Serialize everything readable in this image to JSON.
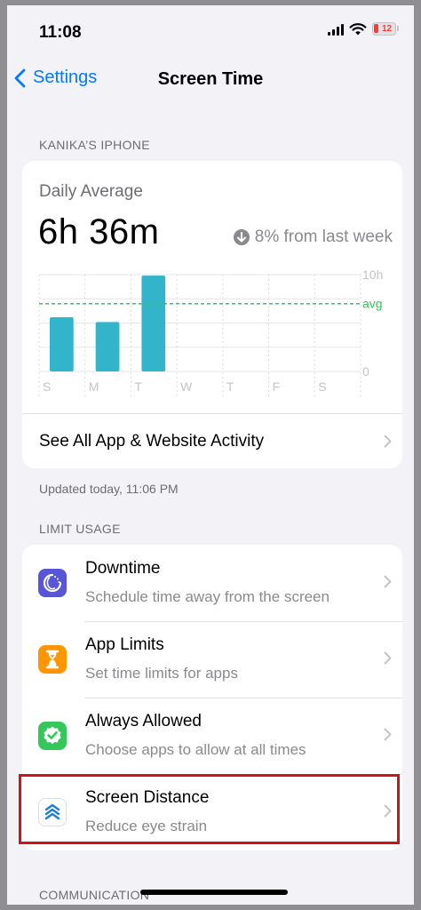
{
  "status_bar": {
    "time": "11:08",
    "battery_level": "12",
    "battery_color": "#ff3b30"
  },
  "nav": {
    "back_label": "Settings",
    "title": "Screen Time"
  },
  "device_section": {
    "header": "KANIKA’S IPHONE"
  },
  "summary": {
    "label": "Daily Average",
    "value": "6h 36m",
    "change": "8% from last week",
    "change_icon": "arrow-down-circle-icon"
  },
  "chart_data": {
    "type": "bar",
    "categories": [
      "S",
      "M",
      "T",
      "W",
      "T",
      "F",
      "S"
    ],
    "values": [
      5.6,
      5.1,
      9.9,
      0,
      0,
      0,
      0
    ],
    "ylim": [
      0,
      10
    ],
    "y_ticks": [
      "10h",
      "0"
    ],
    "average_label": "avg",
    "average_value": 7,
    "bar_color": "#32b4cb",
    "avg_line_color": "#34c759"
  },
  "activity": {
    "label": "See All App & Website Activity"
  },
  "updated_text": "Updated today, 11:06 PM",
  "limit_section": {
    "header": "LIMIT USAGE",
    "items": [
      {
        "title": "Downtime",
        "subtitle": "Schedule time away from the screen",
        "icon": "downtime-icon",
        "color": "#5856d6"
      },
      {
        "title": "App Limits",
        "subtitle": "Set time limits for apps",
        "icon": "hourglass-icon",
        "color": "#ff9500"
      },
      {
        "title": "Always Allowed",
        "subtitle": "Choose apps to allow at all times",
        "icon": "checkmark-seal-icon",
        "color": "#34c759"
      },
      {
        "title": "Screen Distance",
        "subtitle": "Reduce eye strain",
        "icon": "chevrons-up-icon",
        "color": "#1a7fd9"
      }
    ]
  },
  "communication_section": {
    "header": "COMMUNICATION"
  }
}
